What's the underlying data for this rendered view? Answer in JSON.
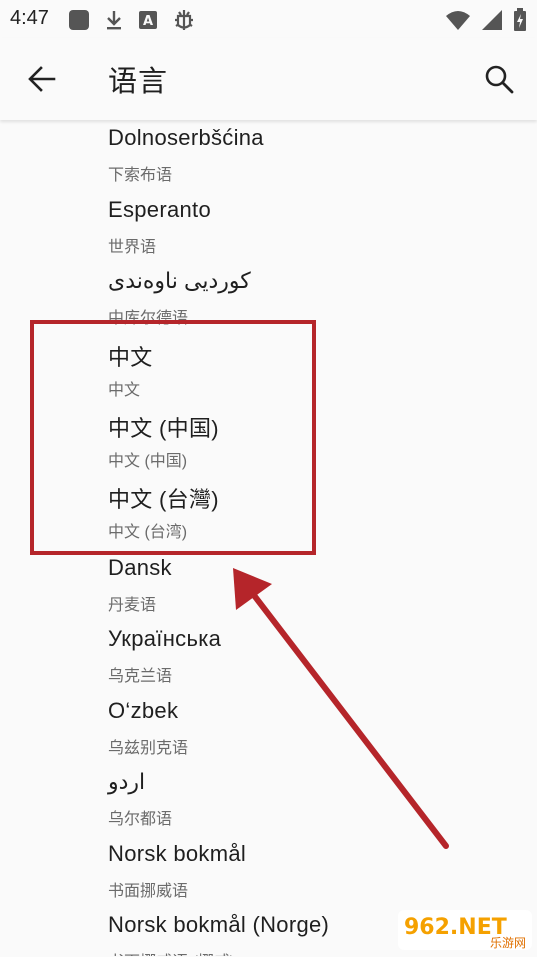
{
  "status_bar": {
    "time": "4:47",
    "left_icons": [
      "app-icon",
      "download-icon",
      "a-box-icon",
      "bug-icon"
    ],
    "right_icons": [
      "wifi-icon",
      "signal-icon",
      "battery-charging-icon"
    ]
  },
  "app_bar": {
    "title": "语言",
    "back_icon": "arrow-back-icon",
    "search_icon": "search-icon"
  },
  "languages": [
    {
      "name": "Dolnoserbšćina",
      "native": "下索布语"
    },
    {
      "name": "Esperanto",
      "native": "世界语"
    },
    {
      "name": "كوردیی ناوەندی",
      "native": "中库尔德语"
    },
    {
      "name": "中文",
      "native": "中文"
    },
    {
      "name": "中文 (中国)",
      "native": "中文 (中国)"
    },
    {
      "name": "中文 (台灣)",
      "native": "中文 (台湾)"
    },
    {
      "name": "Dansk",
      "native": "丹麦语"
    },
    {
      "name": "Українська",
      "native": "乌克兰语"
    },
    {
      "name": "O‘zbek",
      "native": "乌兹别克语"
    },
    {
      "name": "اردو",
      "native": "乌尔都语"
    },
    {
      "name": "Norsk bokmål",
      "native": "书面挪威语"
    },
    {
      "name": "Norsk bokmål (Norge)",
      "native": "书面挪威语 (挪威)"
    }
  ],
  "annotation": {
    "color": "#b5252a"
  },
  "watermark": {
    "brand": "962.NET",
    "sub": "乐游网"
  }
}
